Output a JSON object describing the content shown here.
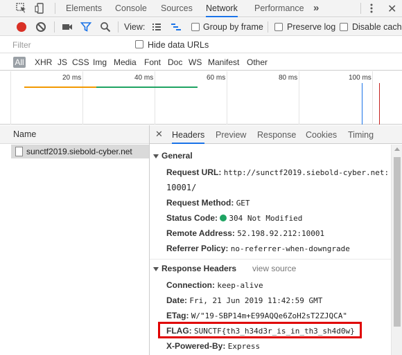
{
  "devtools": {
    "tabs": [
      "Elements",
      "Console",
      "Sources",
      "Network",
      "Performance"
    ],
    "active_tab": "Network",
    "more_label": "»"
  },
  "toolbar": {
    "view_label": "View:",
    "group_by_frame": "Group by frame",
    "preserve_log": "Preserve log",
    "disable_cache": "Disable cache",
    "record_color": "#d93025"
  },
  "filter": {
    "placeholder": "Filter",
    "hide_data_urls": "Hide data URLs"
  },
  "type_filters": [
    "All",
    "XHR",
    "JS",
    "CSS",
    "Img",
    "Media",
    "Font",
    "Doc",
    "WS",
    "Manifest",
    "Other"
  ],
  "timeline": {
    "ticks": [
      "20 ms",
      "40 ms",
      "60 ms",
      "80 ms",
      "100 ms"
    ],
    "colors": {
      "waiting": "#f29900",
      "download": "#1ea362",
      "dom": "#1a73e8",
      "load": "#c5221f"
    }
  },
  "requests": {
    "header": "Name",
    "items": [
      {
        "name": "sunctf2019.siebold-cyber.net"
      }
    ]
  },
  "detail_tabs": [
    "Headers",
    "Preview",
    "Response",
    "Cookies",
    "Timing"
  ],
  "general": {
    "title": "General",
    "request_url_key": "Request URL:",
    "request_url_line1": "http://sunctf2019.siebold-cyber.net:",
    "request_url_line2": "10001/",
    "request_method_key": "Request Method:",
    "request_method": "GET",
    "status_code_key": "Status Code:",
    "status_code": "304 Not Modified",
    "remote_address_key": "Remote Address:",
    "remote_address": "52.198.92.212:10001",
    "referrer_policy_key": "Referrer Policy:",
    "referrer_policy": "no-referrer-when-downgrade"
  },
  "response_headers": {
    "title": "Response Headers",
    "view_source": "view source",
    "connection_key": "Connection:",
    "connection": "keep-alive",
    "date_key": "Date:",
    "date": "Fri, 21 Jun 2019 11:42:59 GMT",
    "etag_key": "ETag:",
    "etag": "W/\"19-SBP14m+E99AQQe6ZoH2sT2ZJQCA\"",
    "flag_key": "FLAG:",
    "flag": "SUNCTF{th3_h34d3r_is_in_th3_sh4d0w}",
    "powered_by_key": "X-Powered-By:",
    "powered_by": "Express"
  }
}
